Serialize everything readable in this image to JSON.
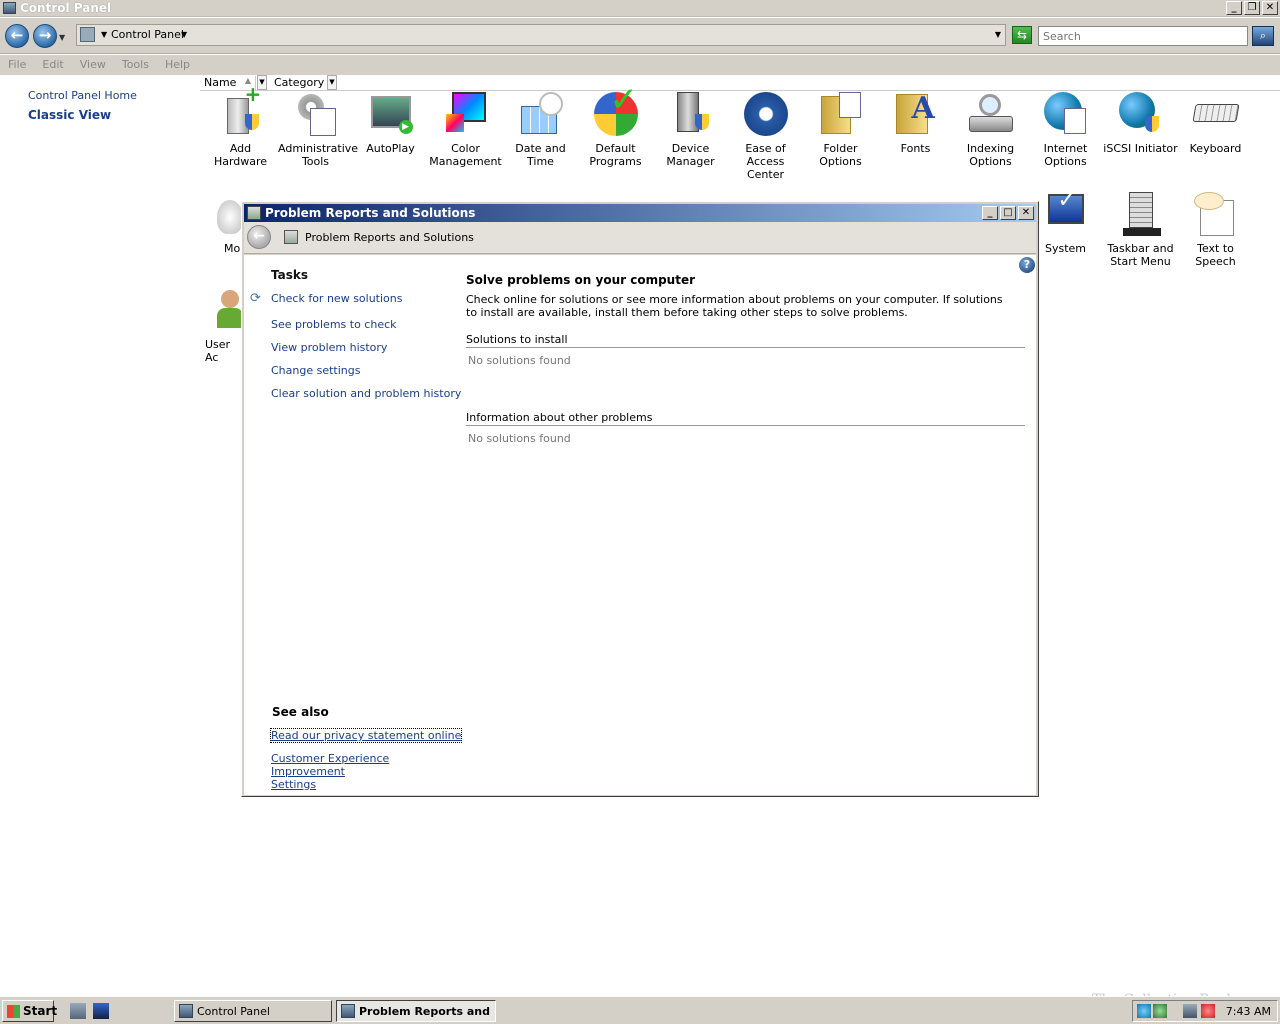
{
  "window": {
    "title": "Control Panel"
  },
  "address": {
    "crumb": "Control Panel",
    "search_placeholder": "Search"
  },
  "menu": [
    "File",
    "Edit",
    "View",
    "Tools",
    "Help"
  ],
  "left_nav": {
    "home": "Control Panel Home",
    "classic": "Classic View"
  },
  "columns": {
    "name": "Name",
    "category": "Category"
  },
  "items_row1": [
    {
      "label": "Add Hardware",
      "icon": "add-hardware-icon"
    },
    {
      "label": "Administrative Tools",
      "icon": "administrative-tools-icon"
    },
    {
      "label": "AutoPlay",
      "icon": "autoplay-icon"
    },
    {
      "label": "Color Management",
      "icon": "color-management-icon"
    },
    {
      "label": "Date and Time",
      "icon": "date-time-icon"
    },
    {
      "label": "Default Programs",
      "icon": "default-programs-icon"
    },
    {
      "label": "Device Manager",
      "icon": "device-manager-icon"
    },
    {
      "label": "Ease of Access Center",
      "icon": "ease-of-access-icon"
    },
    {
      "label": "Folder Options",
      "icon": "folder-options-icon"
    },
    {
      "label": "Fonts",
      "icon": "fonts-icon"
    },
    {
      "label": "Indexing Options",
      "icon": "indexing-options-icon"
    },
    {
      "label": "Internet Options",
      "icon": "internet-options-icon"
    },
    {
      "label": "iSCSI Initiator",
      "icon": "iscsi-initiator-icon"
    },
    {
      "label": "Keyboard",
      "icon": "keyboard-icon"
    }
  ],
  "items_row2_visible": [
    {
      "label": "Mo",
      "icon": "mouse-icon"
    },
    {
      "label": "System",
      "icon": "system-icon"
    },
    {
      "label": "Taskbar and Start Menu",
      "icon": "taskbar-start-menu-icon"
    },
    {
      "label": "Text to Speech",
      "icon": "text-to-speech-icon"
    }
  ],
  "items_row3_visible": [
    {
      "label": "User Ac",
      "icon": "user-accounts-icon"
    }
  ],
  "dialog": {
    "title": "Problem Reports and Solutions",
    "crumb": "Problem Reports and Solutions",
    "tasks_heading": "Tasks",
    "tasks": [
      "Check for new solutions",
      "See problems to check",
      "View problem history",
      "Change settings",
      "Clear solution and problem history"
    ],
    "main_heading": "Solve problems on your computer",
    "main_text": "Check online for solutions or see more information about problems on your computer. If solutions to install are available, install them before taking other steps to solve problems.",
    "sections": [
      {
        "heading": "Solutions to install",
        "value": "No solutions found"
      },
      {
        "heading": "Information about other problems",
        "value": "No solutions found"
      }
    ],
    "see_also_heading": "See also",
    "see_also": [
      "Read our privacy statement online",
      "Customer Experience Improvement Settings"
    ]
  },
  "taskbar": {
    "start": "Start",
    "buttons": [
      "Control Panel",
      "Problem Reports and ..."
    ],
    "clock": "7:43 AM"
  },
  "watermark": "The Collection Book"
}
